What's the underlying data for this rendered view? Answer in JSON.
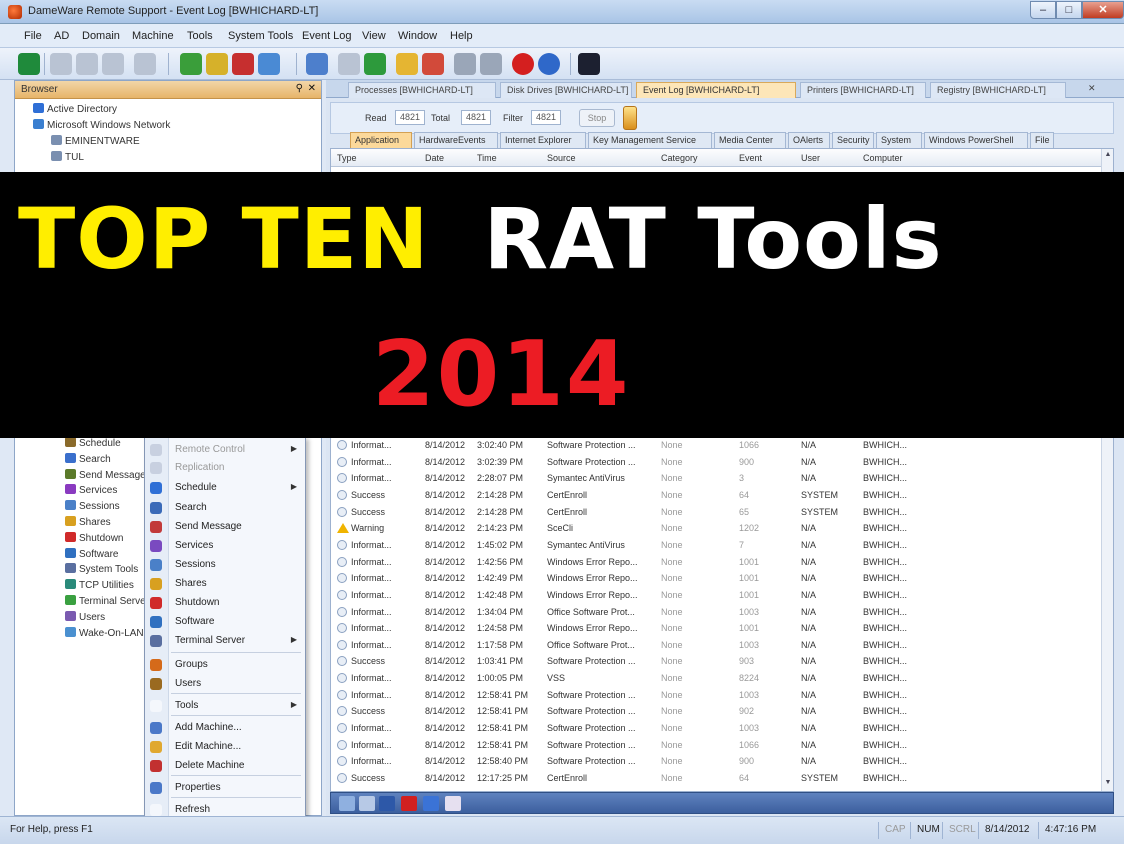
{
  "window": {
    "title": "DameWare Remote Support - Event Log [BWHICHARD-LT]",
    "min": "–",
    "max": "□",
    "close": "✕"
  },
  "menubar": [
    "File",
    "AD",
    "Domain",
    "Machine",
    "Tools",
    "System Tools",
    "Event Log",
    "View",
    "Window",
    "Help"
  ],
  "browser": {
    "header": "Browser",
    "pin": "⚲",
    "close": "✕",
    "tree_top": [
      "Active Directory",
      "Microsoft Windows Network",
      "EMINENTWARE",
      "TUL"
    ],
    "tree_bottom": [
      "Schedule",
      "Search",
      "Send Message",
      "Services",
      "Sessions",
      "Shares",
      "Shutdown",
      "Software",
      "System Tools",
      "TCP Utilities",
      "Terminal Server",
      "Users",
      "Wake-On-LAN"
    ]
  },
  "context_menu": [
    {
      "label": "Remote Control",
      "sub": true,
      "dim": true
    },
    {
      "label": "Replication",
      "sub": false,
      "dim": true
    },
    {
      "label": "Schedule",
      "sub": true
    },
    {
      "label": "Search",
      "sub": false
    },
    {
      "label": "Send Message",
      "sub": false
    },
    {
      "label": "Services",
      "sub": false
    },
    {
      "label": "Sessions",
      "sub": false
    },
    {
      "label": "Shares",
      "sub": false
    },
    {
      "label": "Shutdown",
      "sub": false
    },
    {
      "label": "Software",
      "sub": false
    },
    {
      "label": "Terminal Server",
      "sub": true
    },
    {
      "label": "Groups",
      "sub": false
    },
    {
      "label": "Users",
      "sub": false
    },
    {
      "label": "Tools",
      "sub": true
    },
    {
      "label": "Add Machine...",
      "sub": false
    },
    {
      "label": "Edit Machine...",
      "sub": false
    },
    {
      "label": "Delete Machine",
      "sub": false
    },
    {
      "label": "Properties",
      "sub": false
    },
    {
      "label": "Refresh",
      "sub": false
    }
  ],
  "doc_tabs": [
    "Processes [BWHICHARD-LT]",
    "Disk Drives [BWHICHARD-LT]",
    "Event Log [BWHICHARD-LT]",
    "Printers [BWHICHARD-LT]",
    "Registry [BWHICHARD-LT]"
  ],
  "readbar": {
    "read_label": "Read",
    "read": "4821",
    "total_label": "Total",
    "total": "4821",
    "filter_label": "Filter",
    "filter": "4821",
    "stop": "Stop"
  },
  "log_tabs": [
    "Application",
    "HardwareEvents",
    "Internet Explorer",
    "Key Management Service",
    "Media Center",
    "OAlerts",
    "Security",
    "System",
    "Windows PowerShell",
    "File"
  ],
  "columns": [
    "Type",
    "Date",
    "Time",
    "Source",
    "Category",
    "Event",
    "User",
    "Computer"
  ],
  "rows": [
    [
      "Informat...",
      "8/14/2012",
      "3:02:40 PM",
      "Software Protection ...",
      "None",
      "1066",
      "N/A",
      "BWHICH..."
    ],
    [
      "Informat...",
      "8/14/2012",
      "3:02:39 PM",
      "Software Protection ...",
      "None",
      "900",
      "N/A",
      "BWHICH..."
    ],
    [
      "Informat...",
      "8/14/2012",
      "2:28:07 PM",
      "Symantec AntiVirus",
      "None",
      "3",
      "N/A",
      "BWHICH..."
    ],
    [
      "Success",
      "8/14/2012",
      "2:14:28 PM",
      "CertEnroll",
      "None",
      "64",
      "SYSTEM",
      "BWHICH..."
    ],
    [
      "Success",
      "8/14/2012",
      "2:14:28 PM",
      "CertEnroll",
      "None",
      "65",
      "SYSTEM",
      "BWHICH..."
    ],
    [
      "Warning",
      "8/14/2012",
      "2:14:23 PM",
      "SceCli",
      "None",
      "1202",
      "N/A",
      "BWHICH..."
    ],
    [
      "Informat...",
      "8/14/2012",
      "1:45:02 PM",
      "Symantec AntiVirus",
      "None",
      "7",
      "N/A",
      "BWHICH..."
    ],
    [
      "Informat...",
      "8/14/2012",
      "1:42:56 PM",
      "Windows Error Repo...",
      "None",
      "1001",
      "N/A",
      "BWHICH..."
    ],
    [
      "Informat...",
      "8/14/2012",
      "1:42:49 PM",
      "Windows Error Repo...",
      "None",
      "1001",
      "N/A",
      "BWHICH..."
    ],
    [
      "Informat...",
      "8/14/2012",
      "1:42:48 PM",
      "Windows Error Repo...",
      "None",
      "1001",
      "N/A",
      "BWHICH..."
    ],
    [
      "Informat...",
      "8/14/2012",
      "1:34:04 PM",
      "Office Software Prot...",
      "None",
      "1003",
      "N/A",
      "BWHICH..."
    ],
    [
      "Informat...",
      "8/14/2012",
      "1:24:58 PM",
      "Windows Error Repo...",
      "None",
      "1001",
      "N/A",
      "BWHICH..."
    ],
    [
      "Informat...",
      "8/14/2012",
      "1:17:58 PM",
      "Office Software Prot...",
      "None",
      "1003",
      "N/A",
      "BWHICH..."
    ],
    [
      "Success",
      "8/14/2012",
      "1:03:41 PM",
      "Software Protection ...",
      "None",
      "903",
      "N/A",
      "BWHICH..."
    ],
    [
      "Informat...",
      "8/14/2012",
      "1:00:05 PM",
      "VSS",
      "None",
      "8224",
      "N/A",
      "BWHICH..."
    ],
    [
      "Informat...",
      "8/14/2012",
      "12:58:41 PM",
      "Software Protection ...",
      "None",
      "1003",
      "N/A",
      "BWHICH..."
    ],
    [
      "Success",
      "8/14/2012",
      "12:58:41 PM",
      "Software Protection ...",
      "None",
      "902",
      "N/A",
      "BWHICH..."
    ],
    [
      "Informat...",
      "8/14/2012",
      "12:58:41 PM",
      "Software Protection ...",
      "None",
      "1003",
      "N/A",
      "BWHICH..."
    ],
    [
      "Informat...",
      "8/14/2012",
      "12:58:41 PM",
      "Software Protection ...",
      "None",
      "1066",
      "N/A",
      "BWHICH..."
    ],
    [
      "Informat...",
      "8/14/2012",
      "12:58:40 PM",
      "Software Protection ...",
      "None",
      "900",
      "N/A",
      "BWHICH..."
    ],
    [
      "Success",
      "8/14/2012",
      "12:17:25 PM",
      "CertEnroll",
      "None",
      "64",
      "SYSTEM",
      "BWHICH..."
    ]
  ],
  "statusbar": {
    "help": "For Help, press F1",
    "cap": "CAP",
    "num": "NUM",
    "scrl": "SCRL",
    "date": "8/14/2012",
    "time": "4:47:16 PM"
  },
  "banner": {
    "top_yellow": "TOP TEN",
    "top_white": "RAT Tools",
    "year": "2014"
  },
  "colors": {
    "banner_yellow": "#ffee00",
    "banner_white": "#ffffff",
    "banner_red": "#ec1c24",
    "active_tab": "#fde6b8"
  }
}
